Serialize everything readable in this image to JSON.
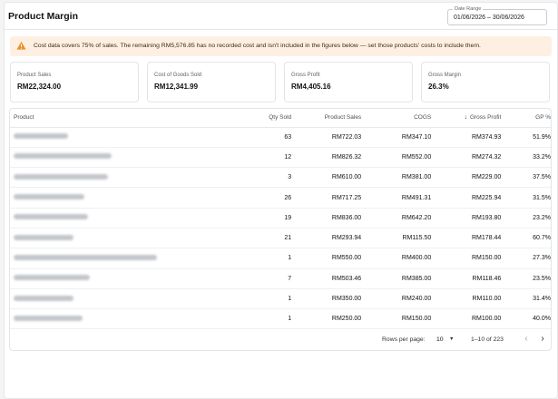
{
  "header": {
    "title": "Product Margin",
    "date_range_label": "Date Range",
    "date_range_value": "01/06/2026 – 30/06/2026"
  },
  "alert": {
    "icon": "warning-icon",
    "color": "#fdf0e3",
    "text": "Cost data covers 75% of sales. The remaining RM5,576.85 has no recorded cost and isn't included in the figures below — set those products' costs to include them."
  },
  "cards": [
    {
      "label": "Product Sales",
      "value": "RM22,324.00"
    },
    {
      "label": "Cost of Goods Sold",
      "value": "RM12,341.99"
    },
    {
      "label": "Gross Profit",
      "value": "RM4,405.16"
    },
    {
      "label": "Gross Margin",
      "value": "26.3%"
    }
  ],
  "table": {
    "columns": [
      "Product",
      "Qty Sold",
      "Product Sales",
      "COGS",
      "Gross Profit",
      "GP %"
    ],
    "sorted_column": "Gross Profit",
    "sort_icon": "arrow-down-icon",
    "rows": [
      {
        "qty": "63",
        "sales": "RM722.03",
        "cogs": "RM347.10",
        "gp": "RM374.93",
        "gp_pct": "51.9%"
      },
      {
        "qty": "12",
        "sales": "RM826.32",
        "cogs": "RM552.00",
        "gp": "RM274.32",
        "gp_pct": "33.2%"
      },
      {
        "qty": "3",
        "sales": "RM610.00",
        "cogs": "RM381.00",
        "gp": "RM229.00",
        "gp_pct": "37.5%"
      },
      {
        "qty": "26",
        "sales": "RM717.25",
        "cogs": "RM491.31",
        "gp": "RM225.94",
        "gp_pct": "31.5%"
      },
      {
        "qty": "19",
        "sales": "RM836.00",
        "cogs": "RM642.20",
        "gp": "RM193.80",
        "gp_pct": "23.2%"
      },
      {
        "qty": "21",
        "sales": "RM293.94",
        "cogs": "RM115.50",
        "gp": "RM178.44",
        "gp_pct": "60.7%"
      },
      {
        "qty": "1",
        "sales": "RM550.00",
        "cogs": "RM400.00",
        "gp": "RM150.00",
        "gp_pct": "27.3%"
      },
      {
        "qty": "7",
        "sales": "RM503.46",
        "cogs": "RM385.00",
        "gp": "RM118.46",
        "gp_pct": "23.5%"
      },
      {
        "qty": "1",
        "sales": "RM350.00",
        "cogs": "RM240.00",
        "gp": "RM110.00",
        "gp_pct": "31.4%"
      },
      {
        "qty": "1",
        "sales": "RM250.00",
        "cogs": "RM150.00",
        "gp": "RM100.00",
        "gp_pct": "40.0%"
      }
    ]
  },
  "pagination": {
    "rows_per_page_label": "Rows per page:",
    "rows_per_page_value": "10",
    "range": "1–10 of 223",
    "prev_icon": "chevron-left-icon",
    "next_icon": "chevron-right-icon"
  }
}
